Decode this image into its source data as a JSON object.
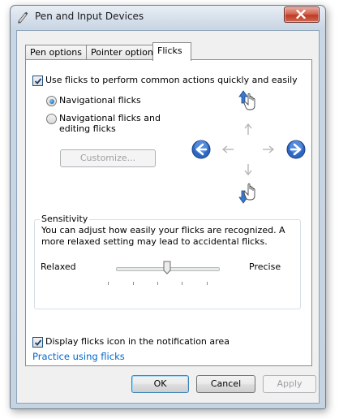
{
  "window": {
    "title": "Pen and Input Devices"
  },
  "tabs": [
    {
      "label": "Pen options",
      "active": false
    },
    {
      "label": "Pointer options",
      "active": false
    },
    {
      "label": "Flicks",
      "active": true
    }
  ],
  "flicks": {
    "use_flicks": {
      "label": "Use flicks to perform common actions quickly and easily",
      "checked": true
    },
    "mode_options": [
      {
        "label": "Navigational flicks",
        "selected": true
      },
      {
        "label": "Navigational flicks and editing flicks",
        "selected": false
      }
    ],
    "customize_label": "Customize...",
    "sensitivity": {
      "title": "Sensitivity",
      "description": "You can adjust how easily your flicks are recognized. A more relaxed setting may lead to accidental flicks.",
      "left_label": "Relaxed",
      "right_label": "Precise",
      "value_fraction": 0.5
    },
    "display_icon": {
      "label": "Display flicks icon in the notification area",
      "checked": true
    },
    "practice_link": "Practice using flicks"
  },
  "buttons": {
    "ok": "OK",
    "cancel": "Cancel",
    "apply": "Apply"
  },
  "icons": {
    "title_icon": "pen-icon",
    "back_arrow": "back-arrow-icon",
    "forward_arrow": "forward-arrow-icon",
    "up_hand": "hand-flick-up-icon",
    "down_hand": "hand-flick-down-icon"
  },
  "colors": {
    "accent": "#1f63b8",
    "link": "#0066cc",
    "close": "#c9432c"
  }
}
